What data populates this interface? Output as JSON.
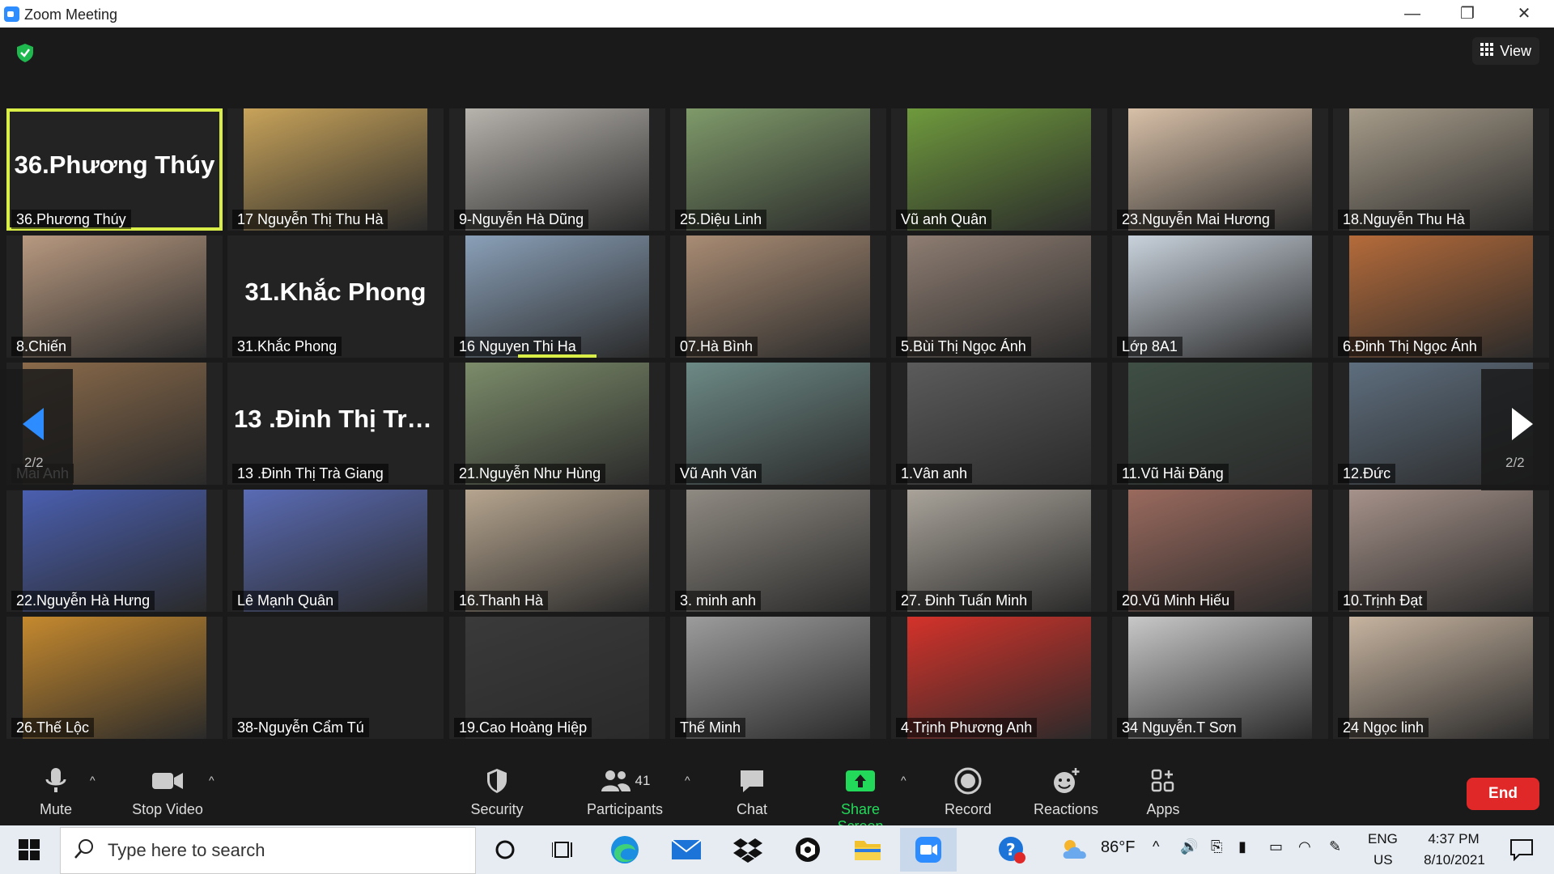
{
  "window": {
    "title": "Zoom Meeting",
    "minimize": "—",
    "restore": "❐",
    "close": "✕"
  },
  "topbar": {
    "view_label": "View"
  },
  "pager": {
    "left_page": "2/2",
    "right_page": "2/2"
  },
  "tiles": [
    {
      "label": "36.Phương Thúy",
      "bigname": "36.Phương Thúy",
      "active": true
    },
    {
      "label": "17 Nguyễn Thị Thu Hà",
      "color": "#c8a35a"
    },
    {
      "label": "9-Nguyễn Hà Dũng",
      "color": "#b7b3ad"
    },
    {
      "label": "25.Diệu Linh",
      "color": "#7f9a6a"
    },
    {
      "label": "Vũ anh Quân",
      "color": "#6f9a3d"
    },
    {
      "label": "23.Nguyễn Mai Hương",
      "color": "#d8c0a8"
    },
    {
      "label": "18.Nguyễn Thu Hà",
      "color": "#a79c8a"
    },
    {
      "label": "8.Chiến",
      "color": "#b89980"
    },
    {
      "label": "31.Khắc Phong",
      "bigname": "31.Khắc Phong"
    },
    {
      "label": "16 Nguyen Thi Ha",
      "color": "#8aa0b8",
      "speaking": true
    },
    {
      "label": "07.Hà Bình",
      "color": "#a98c74"
    },
    {
      "label": "5.Bùi Thị Ngọc Ánh",
      "color": "#8e7d72"
    },
    {
      "label": "Lớp 8A1",
      "color": "#c9d2dc"
    },
    {
      "label": "6.Đinh Thị Ngọc Ánh",
      "color": "#b56b3a"
    },
    {
      "label": "Mai Anh",
      "color": "#8a6a4a"
    },
    {
      "label": "13 .Đinh Thị Trà Giang",
      "bigname": "13 .Đinh Thị Trà..."
    },
    {
      "label": "21.Nguyễn Như Hùng",
      "color": "#7c8c6a"
    },
    {
      "label": "Vũ Anh Văn",
      "color": "#6d8a86"
    },
    {
      "label": "1.Vân anh",
      "color": "#5b5b5b"
    },
    {
      "label": "11.Vũ Hải Đăng",
      "color": "#3f4f45"
    },
    {
      "label": "12.Đức",
      "color": "#5e6e7e"
    },
    {
      "label": "22.Nguyễn Hà Hưng",
      "color": "#4a5fb0"
    },
    {
      "label": "Lê Mạnh Quân",
      "color": "#5a6bb5"
    },
    {
      "label": "16.Thanh Hà",
      "color": "#b6a58f"
    },
    {
      "label": "3. minh anh",
      "color": "#8f8a82"
    },
    {
      "label": "27. Đinh Tuấn Minh",
      "color": "#a9a39a"
    },
    {
      "label": "20.Vũ Minh Hiếu",
      "color": "#9a6a5e"
    },
    {
      "label": "10.Trịnh Đạt",
      "color": "#a6928a"
    },
    {
      "label": "26.Thế Lộc",
      "color": "#c5892e"
    },
    {
      "label": "38-Nguyễn Cẩm Tú"
    },
    {
      "label": "19.Cao Hoàng Hiệp",
      "color": "#3a3a3a"
    },
    {
      "label": "Thế Minh",
      "color": "#9c9c9c"
    },
    {
      "label": "4.Trịnh Phương Anh",
      "color": "#d4322a"
    },
    {
      "label": "34 Nguyễn.T Sơn",
      "color": "#c8c8c8"
    },
    {
      "label": "24 Ngọc linh",
      "color": "#c7b4a0"
    }
  ],
  "toolbar": {
    "mute": "Mute",
    "stop_video": "Stop Video",
    "security": "Security",
    "participants": "Participants",
    "participants_count": "41",
    "chat": "Chat",
    "share_screen": "Share Screen",
    "record": "Record",
    "reactions": "Reactions",
    "apps": "Apps",
    "end": "End",
    "share_color": "#23d959"
  },
  "taskbar": {
    "search_placeholder": "Type here to search",
    "weather": "86°F",
    "language": "ENG",
    "region": "US",
    "time": "4:37 PM",
    "date": "8/10/2021"
  }
}
